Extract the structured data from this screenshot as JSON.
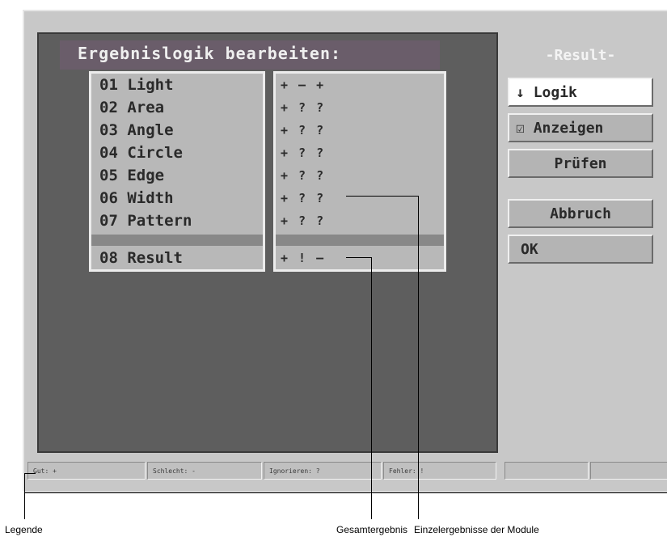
{
  "dialog": {
    "title": "Ergebnislogik bearbeiten:",
    "modules": [
      {
        "label": "01 Light",
        "result": "+ – +"
      },
      {
        "label": "02 Area",
        "result": "+ ? ?"
      },
      {
        "label": "03 Angle",
        "result": "+ ? ?"
      },
      {
        "label": "04 Circle",
        "result": "+ ? ?"
      },
      {
        "label": "05 Edge",
        "result": "+ ? ?"
      },
      {
        "label": "06 Width",
        "result": "+ ? ?"
      },
      {
        "label": "07 Pattern",
        "result": "+ ? ?"
      }
    ],
    "overall": {
      "label": "08 Result",
      "result": "+ ! –"
    }
  },
  "side": {
    "header": "-Result-",
    "logik": "Logik",
    "logik_icon": "↓",
    "anzeigen": "Anzeigen",
    "anzeigen_icon": "☑",
    "pruefen": "Prüfen",
    "abbruch": "Abbruch",
    "ok": "OK"
  },
  "legend": {
    "gut": "Gut: +",
    "schlecht": "Schlecht: -",
    "ignorieren": "Ignorieren: ?",
    "fehler": "Fehler: !"
  },
  "captions": {
    "legende": "Legende",
    "gesamt": "Gesamtergebnis",
    "einzel": "Einzelergebnisse der Module"
  }
}
